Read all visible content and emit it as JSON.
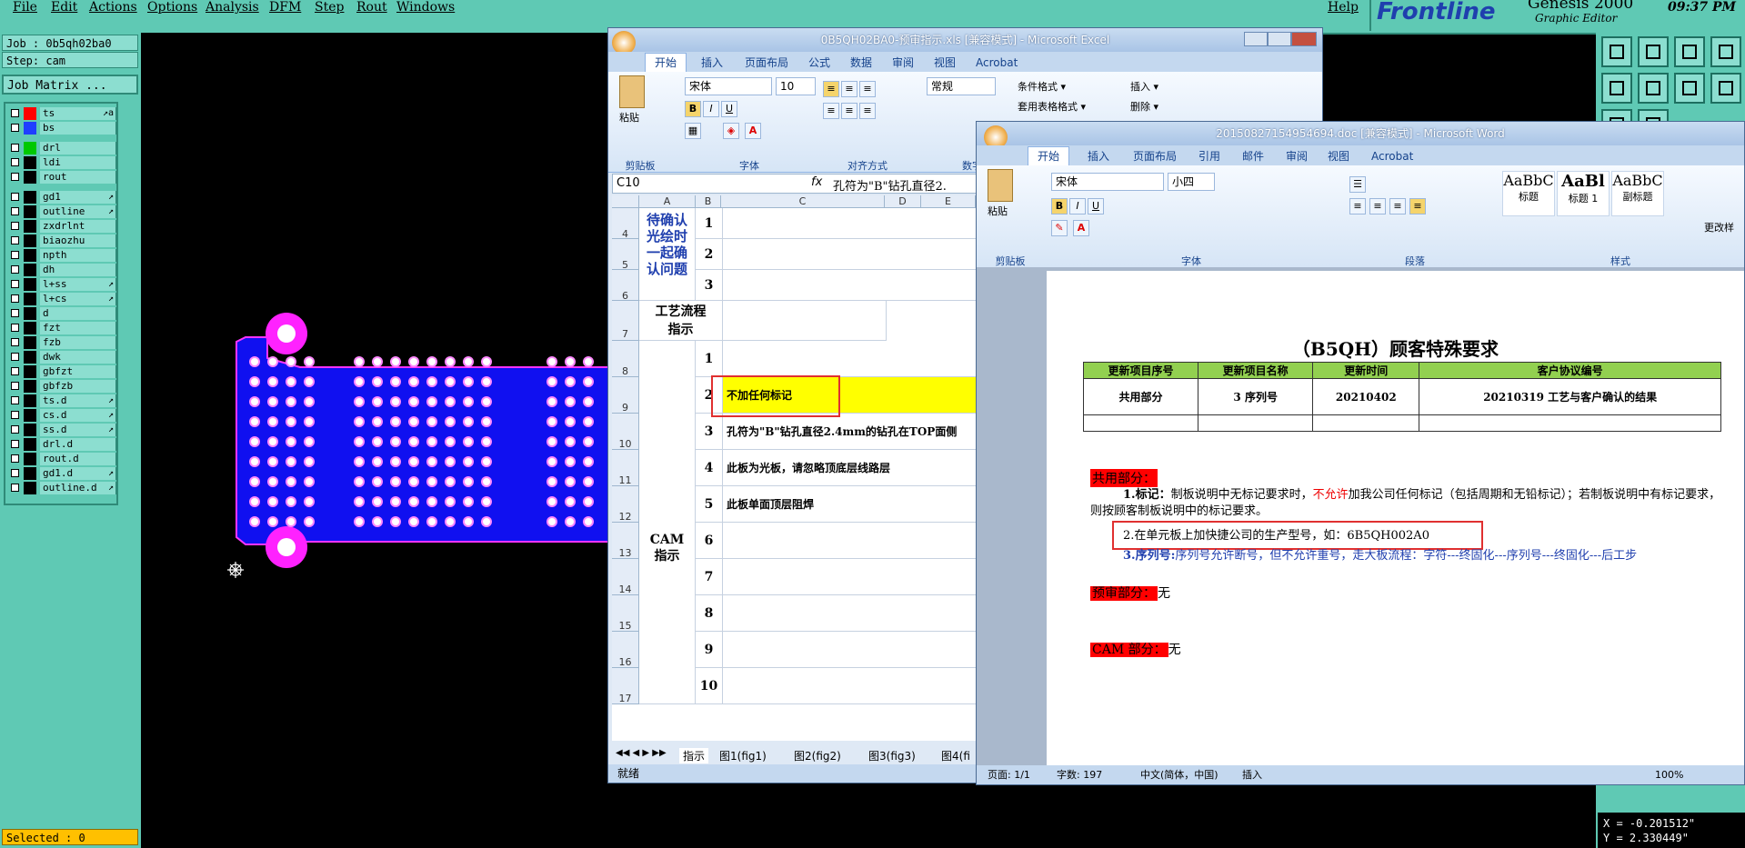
{
  "genesis": {
    "menu": [
      "File",
      "Edit",
      "Actions",
      "Options",
      "Analysis",
      "DFM",
      "Step",
      "Rout",
      "Windows"
    ],
    "help": "Help",
    "brand": "Frontline",
    "product": "Genesis 2000",
    "product_sub": "Graphic Editor",
    "time": "09:37 PM",
    "job": "Job : 0b5qh02ba0",
    "step": "Step: cam",
    "job_matrix": "Job Matrix ...",
    "layers": [
      {
        "name": "ts",
        "color": "#ff0000",
        "arrow": "↗a"
      },
      {
        "name": "bs",
        "color": "#1f3fff",
        "arrow": ""
      },
      {
        "name": "drl",
        "color": "#00c800",
        "arrow": ""
      },
      {
        "name": "ldi",
        "color": "#000000",
        "arrow": ""
      },
      {
        "name": "rout",
        "color": "#000000",
        "arrow": ""
      },
      {
        "name": "gd1",
        "color": "#000000",
        "arrow": "↗"
      },
      {
        "name": "outline",
        "color": "#000000",
        "arrow": "↗"
      },
      {
        "name": "zxdrlnt",
        "color": "#000000",
        "arrow": ""
      },
      {
        "name": "biaozhu",
        "color": "#000000",
        "arrow": ""
      },
      {
        "name": "npth",
        "color": "#000000",
        "arrow": ""
      },
      {
        "name": "dh",
        "color": "#000000",
        "arrow": ""
      },
      {
        "name": "l+ss",
        "color": "#000000",
        "arrow": "↗"
      },
      {
        "name": "l+cs",
        "color": "#000000",
        "arrow": "↗"
      },
      {
        "name": "d",
        "color": "#000000",
        "arrow": ""
      },
      {
        "name": "fzt",
        "color": "#000000",
        "arrow": ""
      },
      {
        "name": "fzb",
        "color": "#000000",
        "arrow": ""
      },
      {
        "name": "dwk",
        "color": "#000000",
        "arrow": ""
      },
      {
        "name": "gbfzt",
        "color": "#000000",
        "arrow": ""
      },
      {
        "name": "gbfzb",
        "color": "#000000",
        "arrow": ""
      },
      {
        "name": "ts.d",
        "color": "#000000",
        "arrow": "↗"
      },
      {
        "name": "cs.d",
        "color": "#000000",
        "arrow": "↗"
      },
      {
        "name": "ss.d",
        "color": "#000000",
        "arrow": "↗"
      },
      {
        "name": "drl.d",
        "color": "#000000",
        "arrow": ""
      },
      {
        "name": "rout.d",
        "color": "#000000",
        "arrow": ""
      },
      {
        "name": "gd1.d",
        "color": "#000000",
        "arrow": "↗"
      },
      {
        "name": "outline.d",
        "color": "#000000",
        "arrow": "↗"
      }
    ],
    "selected": "Selected : 0",
    "coord_x": "X = -0.201512\"",
    "coord_y": "Y = 2.330449\""
  },
  "excel": {
    "title": "0B5QH02BA0-预审指示.xls [兼容模式] - Microsoft Excel",
    "tabs": [
      "开始",
      "插入",
      "页面布局",
      "公式",
      "数据",
      "审阅",
      "视图",
      "Acrobat"
    ],
    "font_name": "宋体",
    "font_size": "10",
    "number_format": "常规",
    "paste_label": "粘贴",
    "cond_format": "条件格式 ▾",
    "table_format": "套用表格格式 ▾",
    "insert_label": "插入 ▾",
    "delete_label": "删除 ▾",
    "group_labels": [
      "剪贴板",
      "字体",
      "对齐方式",
      "数字"
    ],
    "cell_ref": "C10",
    "formula": "孔符为\"B\"钻孔直径2.",
    "col_headers": [
      "A",
      "B",
      "C",
      "D",
      "E"
    ],
    "rows": [
      {
        "num": "4"
      },
      {
        "num": "5"
      },
      {
        "num": "6"
      },
      {
        "num": "7"
      },
      {
        "num": "8"
      },
      {
        "num": "9"
      },
      {
        "num": "10"
      },
      {
        "num": "11"
      },
      {
        "num": "12"
      },
      {
        "num": "13"
      },
      {
        "num": "14"
      },
      {
        "num": "15"
      },
      {
        "num": "16"
      },
      {
        "num": "17"
      }
    ],
    "section_a1": "待确认光绘时一起确认问题",
    "section_a2": "工艺流程指示",
    "section_a3": "CAM指示",
    "b_vals": [
      "1",
      "2",
      "3",
      "",
      "1",
      "2",
      "3",
      "4",
      "5",
      "6",
      "7",
      "8",
      "9",
      "10"
    ],
    "c9": "不加任何标记",
    "c10": "孔符为\"B\"钻孔直径2.4mm的钻孔在TOP面侧",
    "c11": "此板为光板，请忽略顶底层线路层",
    "c12": "此板单面顶层阻焊",
    "sheet_tabs": [
      "指示",
      "图1(fig1)",
      "图2(fig2)",
      "图3(fig3)",
      "图4(fi"
    ],
    "status": "就绪"
  },
  "word": {
    "title": "20150827154954694.doc [兼容模式] - Microsoft Word",
    "tabs": [
      "开始",
      "插入",
      "页面布局",
      "引用",
      "邮件",
      "审阅",
      "视图",
      "Acrobat"
    ],
    "font_name": "宋体",
    "font_size": "小四",
    "paste_label": "粘贴",
    "group_labels": [
      "剪贴板",
      "字体",
      "段落",
      "样式"
    ],
    "styles": [
      {
        "sample": "AaBbC",
        "name": "标题"
      },
      {
        "sample": "AaBl",
        "name": "标题 1"
      },
      {
        "sample": "AaBbC",
        "name": "副标题"
      }
    ],
    "change_styles": "更改样",
    "doc_title": "（B5QH）顾客特殊要求",
    "table_headers": [
      "更新项目序号",
      "更新项目名称",
      "更新时间",
      "客户协议编号"
    ],
    "table_row": [
      "共用部分",
      "3 序列号",
      "20210402",
      "20210319 工艺与客户确认的结果"
    ],
    "sec_common": "共用部分：",
    "item1_label": "1.标记：",
    "item1_a": "制板说明中无标记要求时，",
    "item1_red": "不允许",
    "item1_b": "加我公司任何标记（包括周期和无铅标记）；若制板说明中有标记要求，则按顾客制板说明中的标记要求。",
    "item2": "2.在单元板上加快捷公司的生产型号，如：6B5QH002A0",
    "item3_label": "3.序列号:",
    "item3_text": "序列号允许断号，但不允许重号，走大板流程：字符---终固化---序列号---终固化---后工步",
    "sec_preaudit": "预审部分：",
    "preaudit_val": "无",
    "sec_cam": "CAM 部分：",
    "cam_val": "无",
    "status_page": "页面: 1/1",
    "status_words": "字数: 197",
    "status_lang": "中文(简体，中国)",
    "status_insert": "插入",
    "zoom": "100%"
  }
}
